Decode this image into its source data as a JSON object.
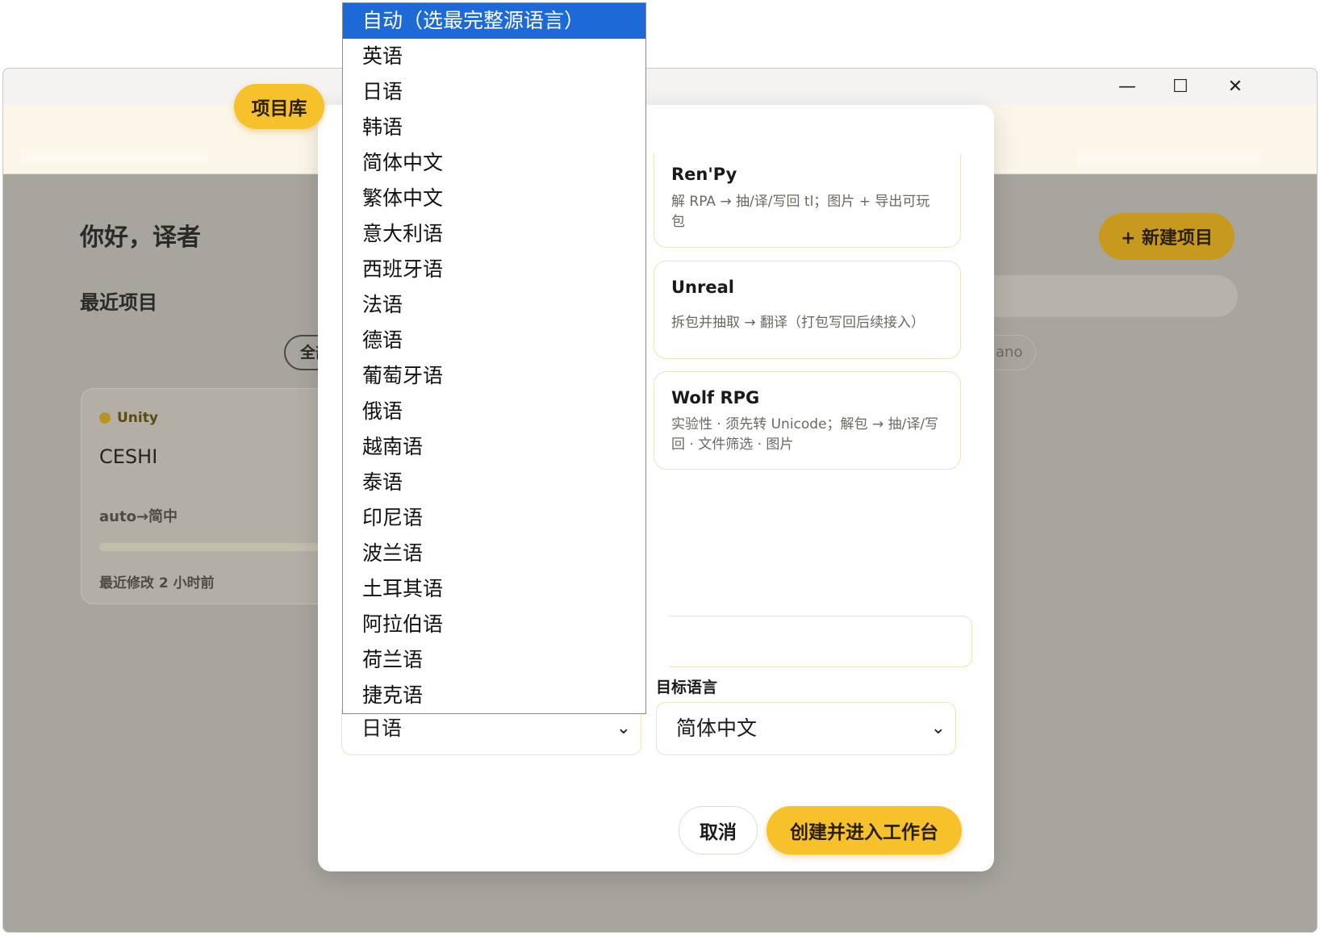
{
  "window": {
    "minimize_glyph": "—",
    "maximize_glyph": "☐",
    "close_glyph": "✕"
  },
  "nav": {
    "project_library": "项目库"
  },
  "home": {
    "greeting": "你好，译者",
    "recent_title": "最近项目",
    "filter_all": "全部",
    "filter_partial": "ano",
    "new_project": "+ 新建项目"
  },
  "project_card": {
    "engine": "Unity",
    "name": "CESHI",
    "languages": "auto→简中",
    "modified": "最近修改 2 小时前"
  },
  "modal": {
    "engines": [
      {
        "name": "Ren'Py",
        "desc": "解 RPA → 抽/译/写回 tl；图片 + 导出可玩包"
      },
      {
        "name": "Unreal",
        "desc": "拆包并抽取 → 翻译（打包写回后续接入）"
      },
      {
        "name": "Wolf RPG",
        "desc": "实验性 · 须先转 Unicode；解包 → 抽/译/写回 · 文件筛选 · 图片"
      }
    ],
    "target_label": "目标语言",
    "source_value": "日语",
    "target_value": "简体中文",
    "cancel": "取消",
    "create": "创建并进入工作台"
  },
  "dropdown": {
    "options": [
      "自动（选最完整源语言）",
      "英语",
      "日语",
      "韩语",
      "简体中文",
      "繁体中文",
      "意大利语",
      "西班牙语",
      "法语",
      "德语",
      "葡萄牙语",
      "俄语",
      "越南语",
      "泰语",
      "印尼语",
      "波兰语",
      "土耳其语",
      "阿拉伯语",
      "荷兰语",
      "捷克语"
    ],
    "selected_index": 0
  },
  "colors": {
    "accent": "#f6c12b",
    "selection_blue": "#1e69d8",
    "overlay": "#a8a59f"
  }
}
